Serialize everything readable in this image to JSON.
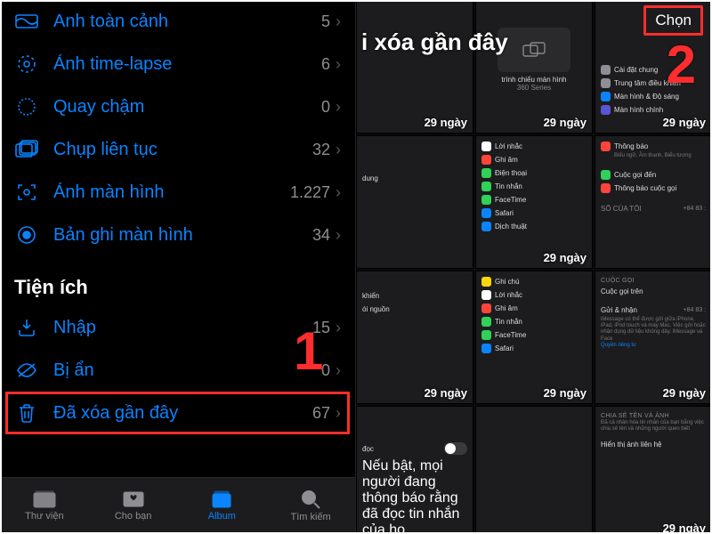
{
  "step1": "1",
  "step2": "2",
  "left": {
    "section_utilities": "Tiện ích",
    "rows": [
      {
        "label": "Anh toàn cảnh",
        "count": "5"
      },
      {
        "label": "Ảnh time-lapse",
        "count": "6"
      },
      {
        "label": "Quay chậm",
        "count": "0"
      },
      {
        "label": "Chụp liên tục",
        "count": "32"
      },
      {
        "label": "Ảnh màn hình",
        "count": "1.227"
      },
      {
        "label": "Bản ghi màn hình",
        "count": "34"
      },
      {
        "label": "Nhập",
        "count": "15"
      },
      {
        "label": "Bị ẩn",
        "count": "0"
      },
      {
        "label": "Đã xóa gần đây",
        "count": "67"
      }
    ],
    "tabs": {
      "library": "Thư viện",
      "for_you": "Cho bạn",
      "albums": "Album",
      "search": "Tìm kiếm"
    }
  },
  "right": {
    "title": "i xóa gần đây",
    "select": "Chọn",
    "days": "29 ngày",
    "settings_snippets": {
      "a": [
        "Cài đặt chung",
        "Trung tâm điều khiển",
        "Màn hình & Độ sáng",
        "Màn hình chính"
      ],
      "b": [
        "Lời nhắc",
        "Ghi âm",
        "Điện thoại",
        "Tin nhắn",
        "FaceTime",
        "Safari",
        "Dịch thuật"
      ],
      "c": [
        "Thông báo",
        "Cuộc gọi đến",
        "Thông báo cuộc gọi"
      ],
      "d": [
        "Ghi chú",
        "Lời nhắc",
        "Ghi âm",
        "Tin nhắn",
        "FaceTime",
        "Safari"
      ],
      "e_sec1": "SỐ CỦA TÔI",
      "e_val1": "+84 83 :",
      "e_sec2": "CUỘC GỌI",
      "e_row2": "Cuộc gọi trên",
      "f_sec1": "Gửi & nhận",
      "f_val1": "+84 83 :",
      "f_sub": "iMessage có thể được gửi giữa iPhone, iPad, iPod touch và máy Mac. Việc gửi hoặc nhận dụng dữ liệu không dây. iMessage và Face",
      "f_link": "Quyền riêng tư",
      "g_sec1": "Chia sẻ tên và ảnh",
      "g_sub": "Đã cá nhân hóa tin nhắn của bạn bằng việc chia sẻ tên và những người quen biết",
      "g_row": "Hiển thị ảnh liên hệ",
      "h_row1": "trình chiếu màn hình",
      "h_row2": "360 Series",
      "i_row": "dung",
      "j_row1": "khiển",
      "j_row2": "ói nguồn"
    }
  }
}
